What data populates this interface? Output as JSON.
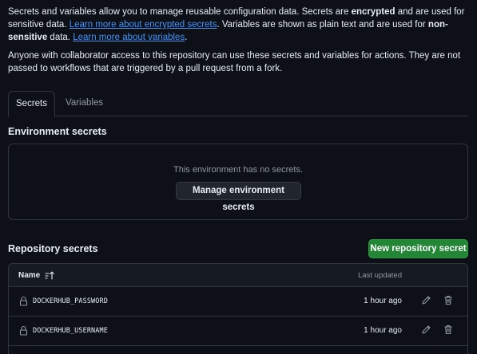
{
  "intro": {
    "p1_a": "Secrets and variables allow you to manage reusable configuration data. Secrets are ",
    "p1_b": "encrypted",
    "p1_c": " and are used for sensitive data. ",
    "p1_link1": "Learn more about encrypted secrets",
    "p1_d": ". Variables are shown as plain text and are used for ",
    "p1_e": "non-sensitive",
    "p1_f": " data. ",
    "p1_link2": "Learn more about variables",
    "p1_g": ".",
    "p2": "Anyone with collaborator access to this repository can use these secrets and variables for actions. They are not passed to workflows that are triggered by a pull request from a fork."
  },
  "tabs": [
    {
      "label": "Secrets",
      "active": true
    },
    {
      "label": "Variables",
      "active": false
    }
  ],
  "environment": {
    "heading": "Environment secrets",
    "empty_text": "This environment has no secrets.",
    "manage_label": "Manage environment secrets"
  },
  "repository": {
    "heading": "Repository secrets",
    "new_label": "New repository secret",
    "columns": {
      "name": "Name",
      "updated": "Last updated"
    },
    "rows": [
      {
        "name": "DOCKERHUB_PASSWORD",
        "updated": "1 hour ago"
      },
      {
        "name": "DOCKERHUB_USERNAME",
        "updated": "1 hour ago"
      }
    ]
  },
  "colors": {
    "background": "#0d1117",
    "border": "#30363d",
    "link": "#4493f8",
    "primary_button": "#238636",
    "muted_text": "#9198a1"
  },
  "icons": [
    "sort-ascending-icon",
    "lock-icon",
    "pencil-icon",
    "trash-icon"
  ]
}
